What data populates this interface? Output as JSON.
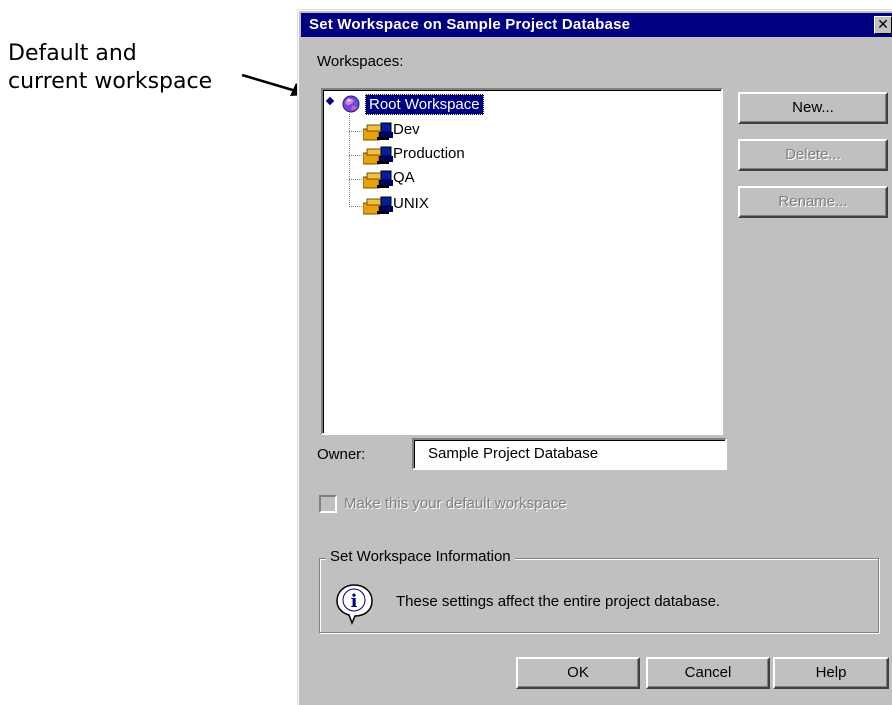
{
  "callout": {
    "line1": "Default and",
    "line2": "current workspace"
  },
  "dialog": {
    "title": "Set Workspace on Sample Project Database",
    "close_glyph": "✕",
    "workspaces_label": "Workspaces:",
    "tree": {
      "root": "Root Workspace",
      "children": [
        "Dev",
        "Production",
        "QA",
        "UNIX"
      ]
    },
    "buttons": {
      "new": "New...",
      "delete": "Delete...",
      "rename": "Rename..."
    },
    "owner_label": "Owner:",
    "owner_value": "Sample Project Database",
    "default_checkbox_label": "Make this your default workspace",
    "group_title": "Set Workspace Information",
    "info_text": "These settings affect the entire project database.",
    "footer": {
      "ok": "OK",
      "cancel": "Cancel",
      "help": "Help"
    }
  },
  "icons": {
    "root": "globe-icon",
    "workspace": "workspace-icon",
    "info": "info-icon"
  }
}
